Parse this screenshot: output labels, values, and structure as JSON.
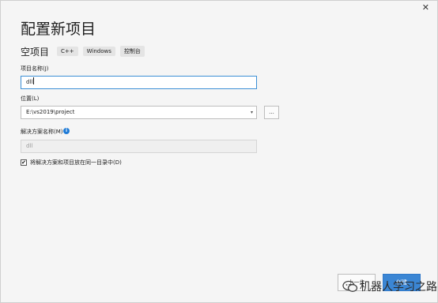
{
  "window": {
    "close_symbol": "✕"
  },
  "page": {
    "title": "配置新项目",
    "subtitle": "空项目",
    "tags": [
      "C++",
      "Windows",
      "控制台"
    ]
  },
  "form": {
    "project_name_label": "项目名称(J)",
    "project_name_value": "dll",
    "location_label": "位置(L)",
    "location_value": "E:\\vs2019\\project",
    "browse_label": "...",
    "solution_name_label": "解决方案名称(M)",
    "solution_name_value": "dll",
    "checkbox_checked": true,
    "checkbox_label": "将解决方案和项目放在同一目录中(D)"
  },
  "buttons": {
    "back": "上一步",
    "create": "创建"
  },
  "watermark": {
    "text": "机器人学习之路"
  }
}
